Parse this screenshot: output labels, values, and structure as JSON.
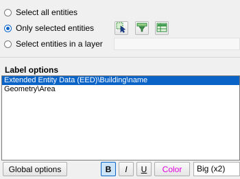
{
  "selection": {
    "options": [
      {
        "label": "Select all entities",
        "checked": false
      },
      {
        "label": "Only selected entities",
        "checked": true
      },
      {
        "label": "Select entities in a layer",
        "checked": false
      }
    ]
  },
  "toolbar": {
    "buttons": [
      {
        "icon": "select-cursor-icon"
      },
      {
        "icon": "filter-select-icon"
      },
      {
        "icon": "table-select-icon"
      }
    ]
  },
  "label_options": {
    "heading": "Label options",
    "items": [
      {
        "text": "Extended Entity Data (EED)\\Building\\name",
        "selected": true
      },
      {
        "text": "Geometry\\Area",
        "selected": false
      }
    ]
  },
  "footer": {
    "global_options_label": "Global options",
    "bold_label": "B",
    "bold_active": true,
    "italic_label": "I",
    "underline_label": "U",
    "color_label": "Color",
    "color_value": "#e000e0",
    "size_value": "Big (x2)"
  }
}
